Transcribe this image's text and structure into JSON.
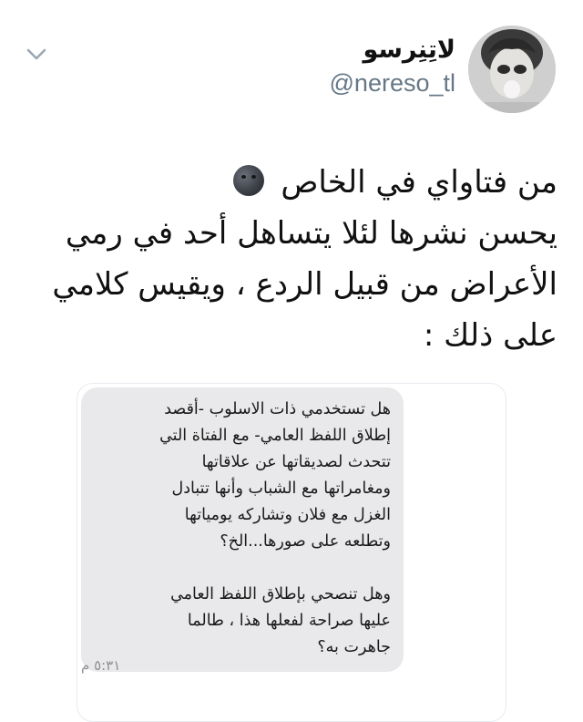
{
  "tweet": {
    "display_name": "لاتِنِرسو",
    "handle": "@nereso_tl",
    "text_lines": [
      "من فتاواي في الخاص",
      "يحسن نشرها لئلا يتساهل أحد في رمي",
      "الأعراض من قبيل الردع ، ويقيس كلامي",
      "على ذلك  :"
    ],
    "emoji": "new-moon-face"
  },
  "embedded_message": {
    "paragraph1": [
      "هل تستخدمي ذات الاسلوب -أقصد",
      "إطلاق اللفظ العامي- مع الفتاة التي",
      "تتحدث لصديقاتها عن علاقاتها",
      "ومغامراتها مع الشباب وأنها تتبادل",
      "الغزل مع فلان وتشاركه يومياتها",
      "وتطلعه على صورها...الخ؟"
    ],
    "paragraph2": [
      "وهل تنصحي بإطلاق اللفظ العامي",
      "عليها صراحة لفعلها هذا ، طالما",
      "جاهرت به؟"
    ],
    "timestamp": "٥:٣١ م"
  },
  "icons": {
    "chevron": "chevron-down-icon",
    "avatar": "avatar"
  },
  "colors": {
    "handle": "#657786",
    "bubble": "#e9e9eb",
    "card_border": "#e6ecf0"
  }
}
